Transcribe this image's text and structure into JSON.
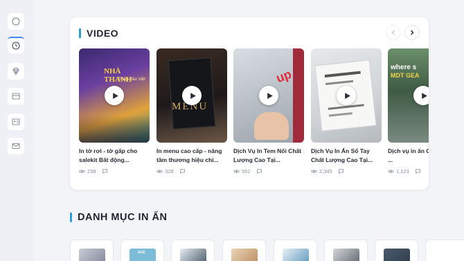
{
  "sidebar": {
    "items": [
      {
        "icon": "circle-icon"
      },
      {
        "icon": "clock-icon",
        "active": true
      },
      {
        "icon": "diamond-icon"
      },
      {
        "icon": "card-icon"
      },
      {
        "icon": "id-card-icon"
      },
      {
        "icon": "mail-icon"
      }
    ]
  },
  "video_section": {
    "title": "VIDEO",
    "accent": "#2d9cdb",
    "prev_icon": "chevron-left-icon",
    "next_icon": "chevron-right-icon",
    "videos": [
      {
        "title": "In tờ rơi - tờ gấp cho salekit Bất động...",
        "views": "298",
        "thumb_caption": "NHÀ THANH",
        "thumb_sub": "Trọng Hầu Việt"
      },
      {
        "title": "In menu cao cấp - nâng tầm thương hiệu chỉ...",
        "views": "328",
        "thumb_caption": "MENU",
        "thumb_sub": ""
      },
      {
        "title": "Dịch Vụ In Tem Nổi Chất Lượng Cao Tại...",
        "views": "562",
        "thumb_caption": "up",
        "thumb_sub": ""
      },
      {
        "title": "Dịch Vụ In Ấn Sổ Tay Chất Lượng Cao Tại...",
        "views": "2,345",
        "thumb_caption": "",
        "thumb_sub": ""
      },
      {
        "title": "Dịch vụ in ấn Catalogue ...",
        "views": "1,123",
        "thumb_caption": "where s",
        "thumb_sub": "MDT GEA"
      }
    ]
  },
  "category_section": {
    "title": "DANH MỤC IN ẤN",
    "items": [
      {
        "name": "category-1",
        "color": "#8a8fa0"
      },
      {
        "name": "category-2",
        "color": "#5aa7c9",
        "label": "ACE"
      },
      {
        "name": "category-3",
        "color": "#3a4a5a"
      },
      {
        "name": "category-4",
        "color": "#c8a27a"
      },
      {
        "name": "category-5",
        "color": "#4f8fb8"
      },
      {
        "name": "category-6",
        "color": "#555a66"
      },
      {
        "name": "category-7",
        "color": "#2f3a48"
      }
    ]
  }
}
